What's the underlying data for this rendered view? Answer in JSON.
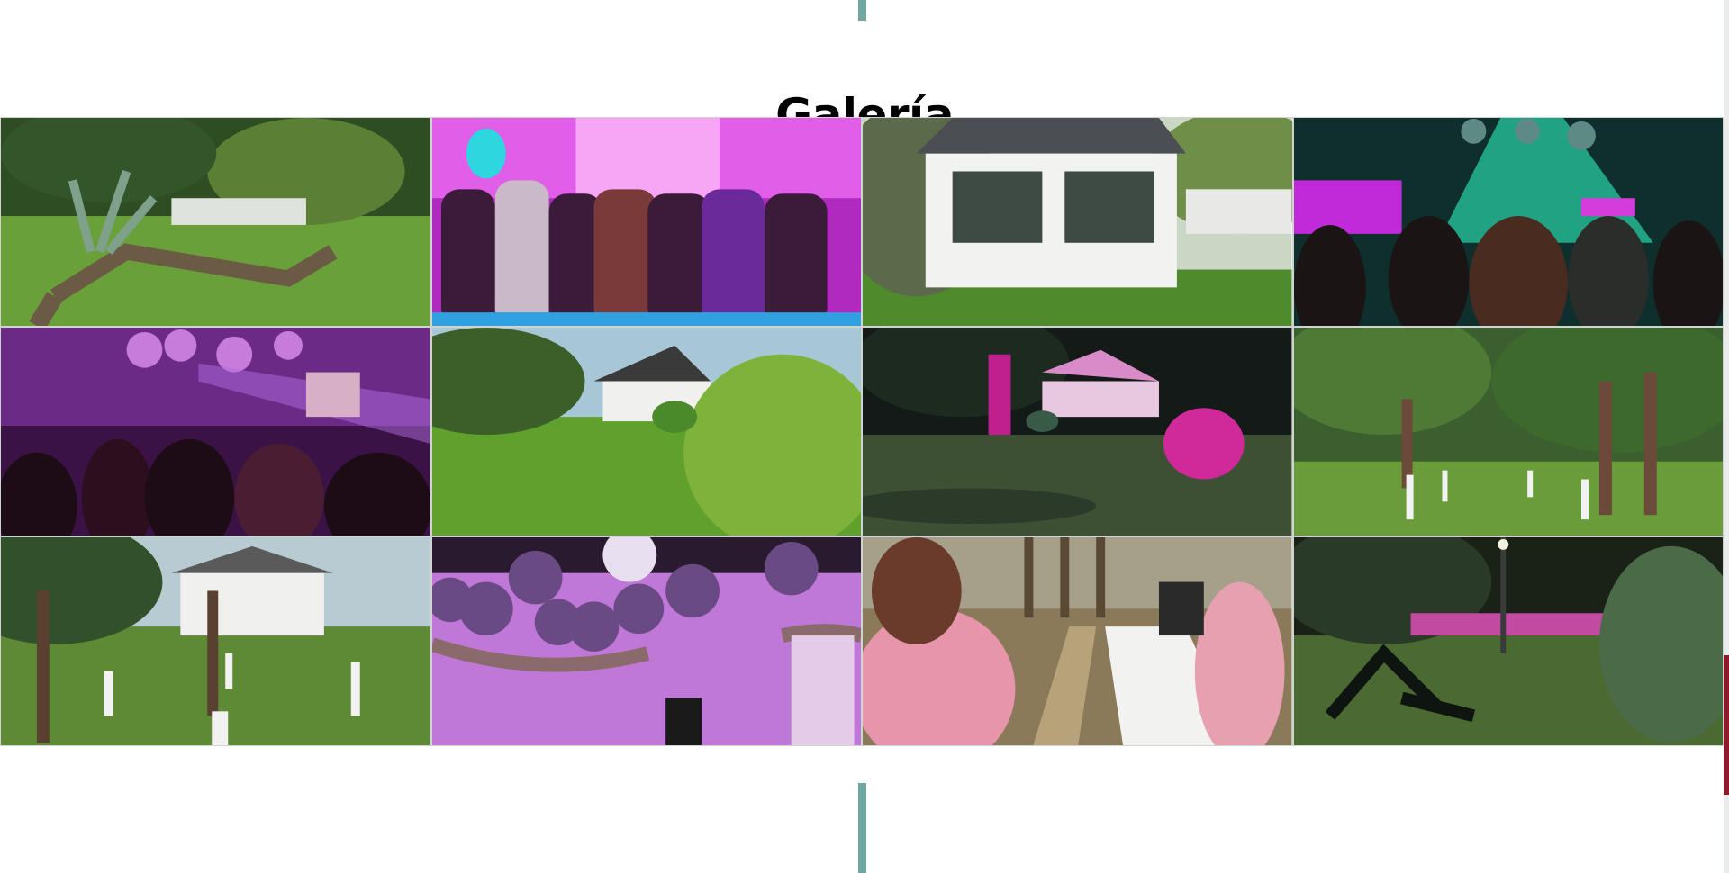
{
  "section": {
    "title": "Galería"
  },
  "gallery": {
    "items": [
      {
        "icon": "garden-palm-photo"
      },
      {
        "icon": "party-dance-photo"
      },
      {
        "icon": "gazebo-photo"
      },
      {
        "icon": "dance-floor-lights-photo"
      },
      {
        "icon": "purple-party-photo"
      },
      {
        "icon": "house-lawn-photo"
      },
      {
        "icon": "night-house-photo"
      },
      {
        "icon": "palm-park-photo"
      },
      {
        "icon": "tree-path-photo"
      },
      {
        "icon": "disco-balls-photo"
      },
      {
        "icon": "ceremony-aisle-photo"
      },
      {
        "icon": "night-garden-photo"
      }
    ]
  },
  "colors": {
    "accent": "#6fa8a1",
    "scroll_mark": "#8e1b2c"
  }
}
